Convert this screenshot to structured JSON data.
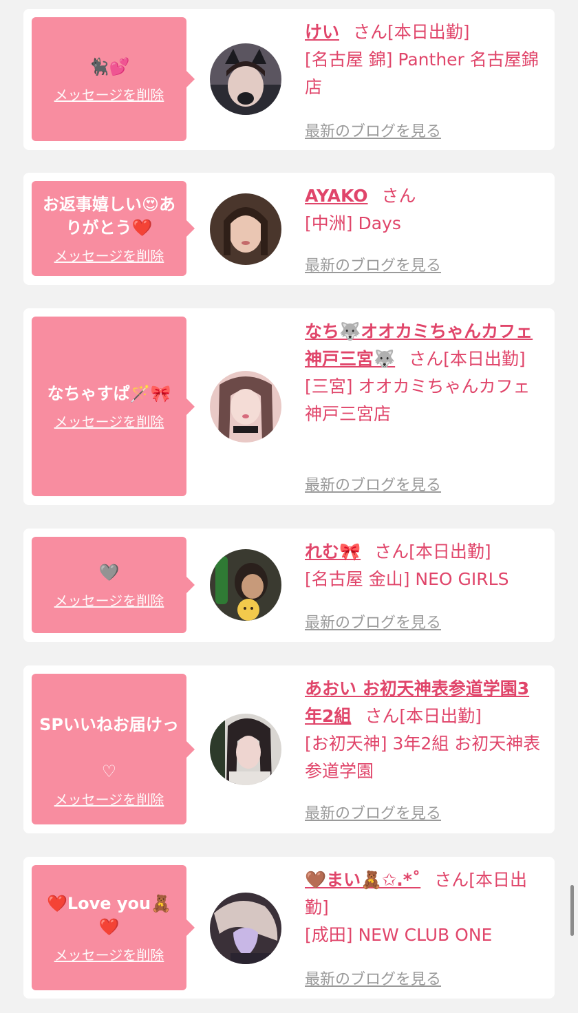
{
  "colors": {
    "accent": "#e0456a",
    "bubble": "#f88da0",
    "background": "#f2f2f2"
  },
  "delete_label": "メッセージを削除",
  "blog_label": "最新のブログを見る",
  "cards": [
    {
      "message": "🐈‍⬛💕",
      "name": "けい",
      "san": "さん[本日出勤]",
      "shop": "[名古屋 錦] Panther 名古屋錦店",
      "avatar_colors": [
        "#2b2b33",
        "#d9c6c0",
        "#3a2a2a"
      ]
    },
    {
      "message": "お返事嬉しい😍ありがとう❤️",
      "name": "AYAKO",
      "san": "さん",
      "shop": "[中洲] Days",
      "avatar_colors": [
        "#3d2a22",
        "#e8c3b0",
        "#5a3c30"
      ]
    },
    {
      "message": "なちゃすぱ🪄🎀",
      "name": "なち🐺オオカミちゃんカフェ神戸三宮🐺",
      "san": "さん[本日出勤]",
      "shop": "[三宮] オオカミちゃんカフェ神戸三宮店",
      "avatar_colors": [
        "#f0d4d0",
        "#d88a94",
        "#3b2a2e"
      ]
    },
    {
      "message": "🩶",
      "name": "れむ🎀",
      "san": "さん[本日出勤]",
      "shop": "[名古屋 金山] NEO GIRLS",
      "avatar_colors": [
        "#2c5a2e",
        "#3a2a22",
        "#f1c84a"
      ]
    },
    {
      "message": "SPいいねお届けっ",
      "message_sub": "♡",
      "name": "あおい お初天神表参道学園3年2組",
      "san": "さん[本日出勤]",
      "shop": "[お初天神] 3年2組 お初天神表参道学園",
      "avatar_colors": [
        "#2d3a2a",
        "#e9d2cf",
        "#2a2426"
      ]
    },
    {
      "message": "❤️Love you🧸❤️",
      "name": "🤎まい🧸✩.*˚",
      "san": "さん[本日出勤]",
      "shop": "[成田] NEW CLUB ONE",
      "avatar_colors": [
        "#3a3038",
        "#d8c8c4",
        "#b9a7d8"
      ]
    }
  ]
}
